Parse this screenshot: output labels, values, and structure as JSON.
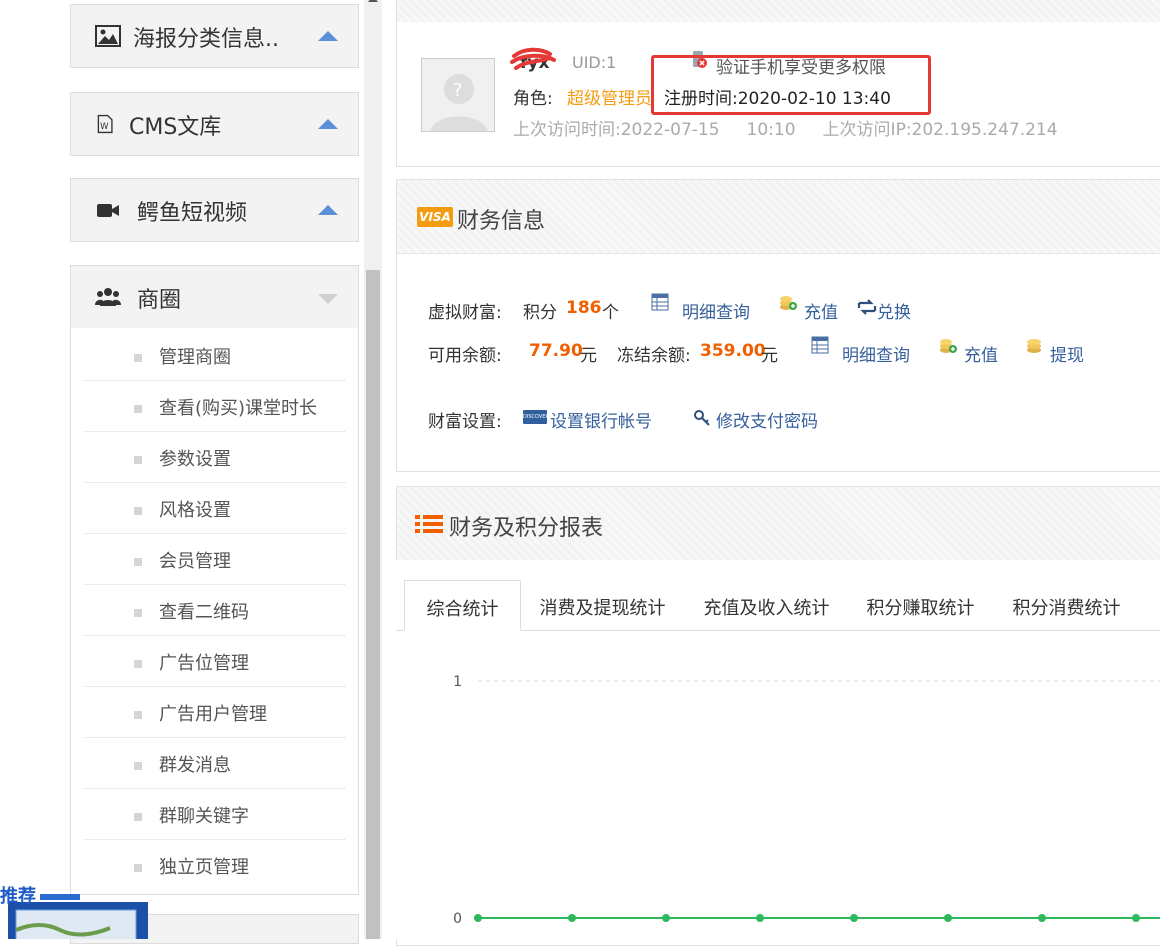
{
  "sidebar": {
    "sections": [
      {
        "label": "海报分类信息..",
        "icon": "image-icon",
        "state": "collapsed"
      },
      {
        "label": "CMS文库",
        "icon": "word-document-icon",
        "state": "collapsed"
      },
      {
        "label": "鳄鱼短视频",
        "icon": "video-camera-icon",
        "state": "collapsed"
      },
      {
        "label": "商圈",
        "icon": "users-icon",
        "state": "expanded"
      }
    ],
    "business_items": [
      "管理商圈",
      "查看(购买)课堂时长",
      "参数设置",
      "风格设置",
      "会员管理",
      "查看二维码",
      "广告位管理",
      "广告用户管理",
      "群发消息",
      "群聊关键字",
      "独立页管理"
    ],
    "promo_text": "推荐"
  },
  "profile": {
    "username": "fyx",
    "uid": "UID:1",
    "verify_phone": "验证手机享受更多权限",
    "role_label": "角色:",
    "role_value": "超级管理员",
    "register_time": "注册时间:2020-02-10  13:40",
    "last_visit": "上次访问时间:2022-07-15     10:10     上次访问IP:202.195.247.214"
  },
  "finance": {
    "title": "财务信息",
    "visa_badge": "VISA",
    "virtual_wealth_label": "虚拟财富:",
    "points_label": "积分",
    "points_value": "186",
    "points_unit": "个",
    "detail_query": "明细查询",
    "recharge": "充值",
    "exchange": "兑换",
    "available_label": "可用余额:",
    "available_value": "77.90",
    "currency_unit": "元",
    "frozen_label": "冻结余额:",
    "frozen_value": "359.00",
    "withdraw": "提现",
    "wealth_settings_label": "财富设置:",
    "set_bank_account": "设置银行帐号",
    "change_pay_password": "修改支付密码",
    "card_badge": "DISCOVER"
  },
  "report": {
    "title": "财务及积分报表",
    "tabs": [
      "综合统计",
      "消费及提现统计",
      "充值及收入统计",
      "积分赚取统计",
      "积分消费统计"
    ],
    "active_tab": 0
  },
  "chart_data": {
    "type": "line",
    "title": "",
    "xlabel": "",
    "ylabel": "",
    "ylim": [
      0,
      1
    ],
    "y_ticks": [
      "0",
      "1"
    ],
    "series": [
      {
        "values": [
          0,
          0,
          0,
          0,
          0,
          0,
          0,
          0,
          0,
          0,
          0,
          0,
          0,
          0,
          0,
          0
        ],
        "color": "#2eb85c"
      }
    ],
    "grid": true
  },
  "colors": {
    "accent_blue": "#5b8fd8",
    "orange": "#f06000",
    "role_orange": "#f39c12",
    "highlight_red": "#e53935",
    "line_green": "#2eb85c"
  }
}
